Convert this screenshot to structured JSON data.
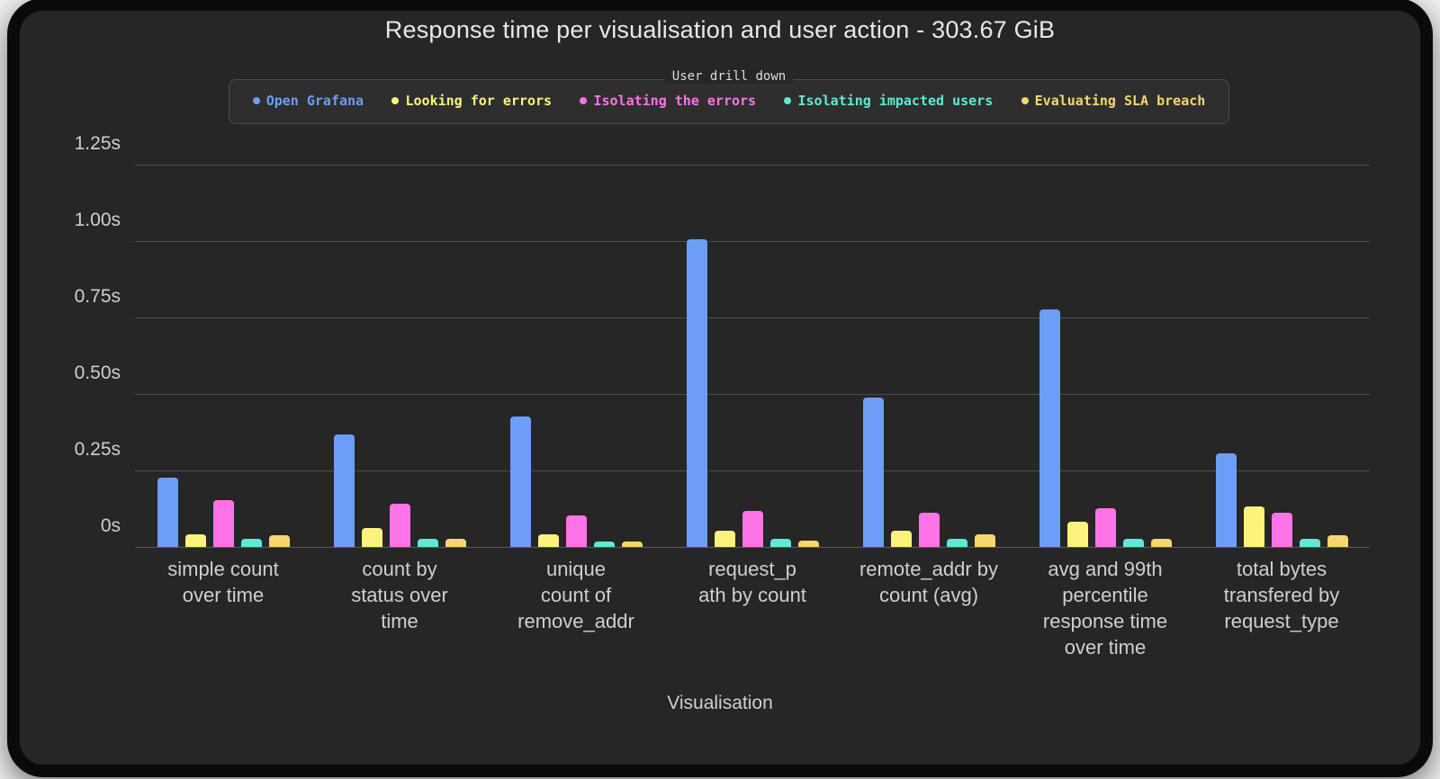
{
  "chart_data": {
    "type": "bar",
    "title": "Response time per visualisation and user action - 303.67 GiB",
    "xlabel": "Visualisation",
    "ylabel": "",
    "legend_title": "User drill down",
    "legend_position": "top",
    "grid": true,
    "ylim": [
      0,
      1.3
    ],
    "ytick_values": [
      0,
      0.25,
      0.5,
      0.75,
      1.0,
      1.25
    ],
    "ytick_labels": [
      "0s",
      "0.25s",
      "0.50s",
      "0.75s",
      "1.00s",
      "1.25s"
    ],
    "categories": [
      "simple count over time",
      "count by status over time",
      "unique count of remove_addr",
      "request_path by count",
      "remote_addr by count (avg)",
      "avg and 99th percentile response time over time",
      "total bytes transfered by request_type"
    ],
    "category_lines": [
      [
        "simple count",
        "over time"
      ],
      [
        "count by",
        "status over",
        "time"
      ],
      [
        "unique",
        "count of",
        "remove_addr"
      ],
      [
        "request_p",
        "ath by count"
      ],
      [
        "remote_addr by",
        "count (avg)"
      ],
      [
        "avg and 99th",
        "percentile",
        "response time",
        "over time"
      ],
      [
        "total bytes",
        "transfered by",
        "request_type"
      ]
    ],
    "series": [
      {
        "name": "Open Grafana",
        "color": "#6c9ef8",
        "values": [
          0.23,
          0.37,
          0.43,
          1.01,
          0.49,
          0.78,
          0.31
        ]
      },
      {
        "name": "Looking for errors",
        "color": "#fbf37c",
        "values": [
          0.045,
          0.065,
          0.045,
          0.055,
          0.055,
          0.085,
          0.135
        ]
      },
      {
        "name": "Isolating the errors",
        "color": "#ff73e8",
        "values": [
          0.155,
          0.145,
          0.105,
          0.12,
          0.115,
          0.13,
          0.115
        ]
      },
      {
        "name": "Isolating impacted users",
        "color": "#5eead4",
        "values": [
          0.03,
          0.03,
          0.02,
          0.03,
          0.03,
          0.03,
          0.03
        ]
      },
      {
        "name": "Evaluating SLA breach",
        "color": "#f5d76e",
        "values": [
          0.04,
          0.03,
          0.02,
          0.025,
          0.045,
          0.03,
          0.04
        ]
      }
    ]
  }
}
